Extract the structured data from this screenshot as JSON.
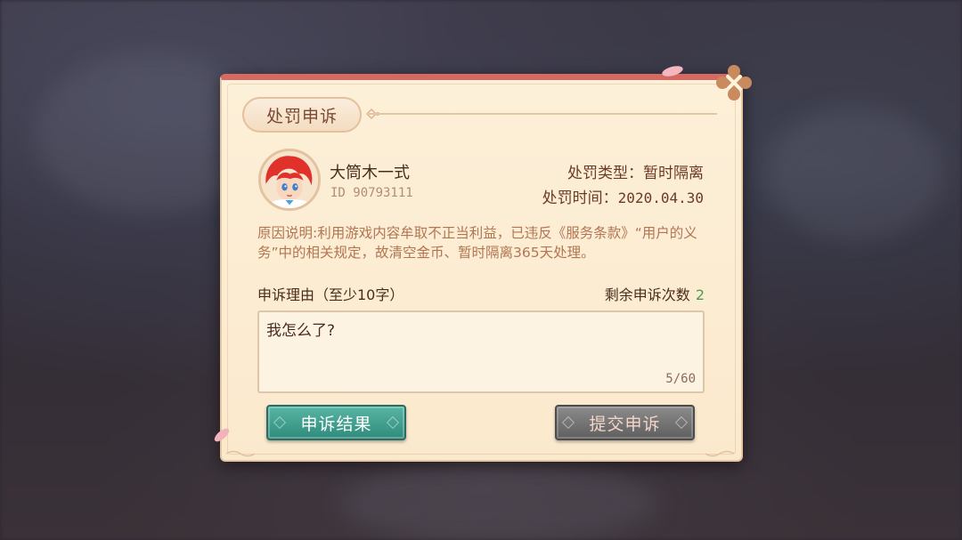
{
  "dialog": {
    "title": "处罚申诉",
    "player": {
      "name": "大筒木一式",
      "id": "ID 90793111"
    },
    "penalty": {
      "type_label": "处罚类型：",
      "type_value": "暂时隔离",
      "time_label": "处罚时间：",
      "time_value": "2020.04.30"
    },
    "reason": "原因说明:利用游戏内容牟取不正当利益，已违反《服务条款》“用户的义务”中的相关规定，故清空金币、暂时隔离365天处理。",
    "appeal": {
      "label": "申诉理由（至少10字）",
      "remaining_label": "剩余申诉次数",
      "remaining_count": "2",
      "input_value": "我怎么了?",
      "char_counter": "5/60"
    },
    "buttons": {
      "result": "申诉结果",
      "submit": "提交申诉"
    }
  },
  "colors": {
    "header_bar": "#d46a61",
    "panel_bg": "#fdf0d8",
    "result_button": "#3f9d8c",
    "submit_button": "#707070",
    "reason_text": "#b27552",
    "remaining_count": "#4aa04a"
  },
  "icons": {
    "close": "close-x-icon",
    "avatar": "red-haired-character-avatar"
  }
}
